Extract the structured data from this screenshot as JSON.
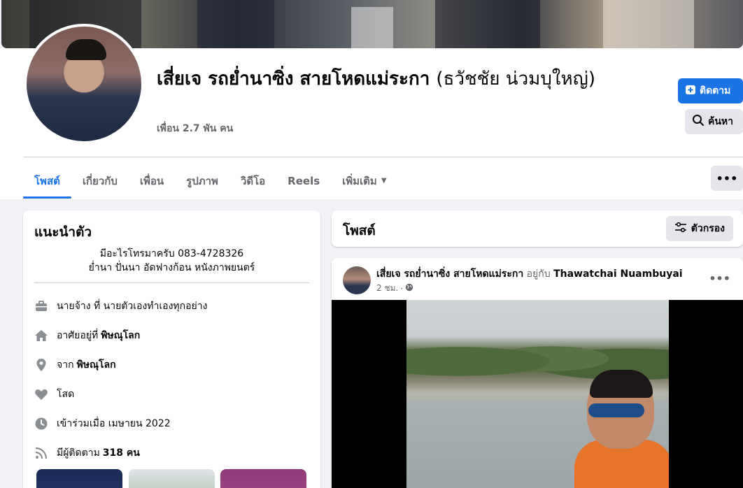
{
  "profile": {
    "name_main": "เสี่ยเจ รถย่ำนาซิ่ง สายโหดแม่ระกา",
    "name_alt": "(ธวัชชัย น่วมบุใหญ่)",
    "friends": "เพื่อน 2.7 พัน คน"
  },
  "actions": {
    "follow_label": "ติดตาม",
    "search_label": "ค้นหา"
  },
  "tabs": [
    {
      "label": "โพสต์"
    },
    {
      "label": "เกี่ยวกับ"
    },
    {
      "label": "เพื่อน"
    },
    {
      "label": "รูปภาพ"
    },
    {
      "label": "วิดีโอ"
    },
    {
      "label": "Reels"
    },
    {
      "label": "เพิ่มเติม"
    }
  ],
  "more_label": "•••",
  "intro": {
    "title": "แนะนำตัว",
    "bio_line1": "มีอะไรโทรมาครับ 083-4728326",
    "bio_line2": "ย่ำนา ปั่นนา อัดฟางก้อน หนังภาพยนตร์",
    "work": "นายจ้าง ที่ นายตัวเองทำเองทุกอย่าง",
    "lives_prefix": "อาศัยอยู่ที่",
    "lives_place": "พิษณุโลก",
    "from_prefix": "จาก",
    "from_place": "พิษณุโลก",
    "relationship": "โสด",
    "joined": "เข้าร่วมเมื่อ เมษายน 2022",
    "followers_prefix": "มีผู้ติดตาม",
    "followers_count": "318 คน"
  },
  "posts": {
    "title": "โพสต์",
    "filter_label": "ตัวกรอง"
  },
  "post": {
    "author": "เสี่ยเจ รถย่ำนาซิ่ง สายโหดแม่ระกา",
    "with": "อยู่กับ",
    "tagged": "Thawatchai Nuambuyai",
    "time": "2 ชม.",
    "dot": "·",
    "menu": "•••"
  },
  "colors": {
    "accent": "#1b74e4",
    "background": "#f0f2f5",
    "secondary_text": "#65676b"
  }
}
